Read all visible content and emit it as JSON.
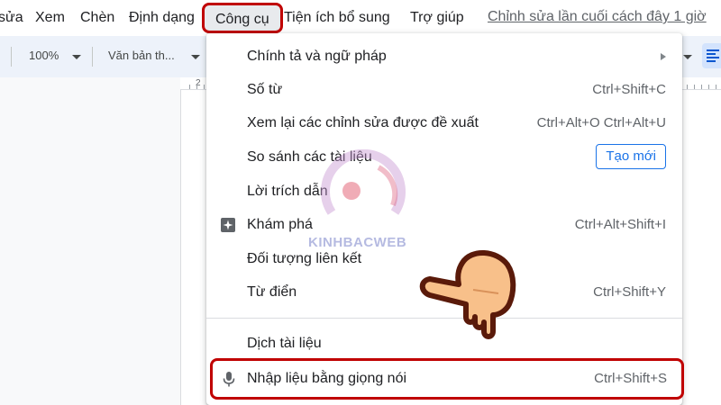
{
  "menubar": {
    "items": [
      "sửa",
      "Xem",
      "Chèn",
      "Định dạng",
      "Công cụ",
      "Tiện ích bổ sung",
      "Trợ giúp"
    ],
    "last_edit": "Chỉnh sửa lần cuối cách đây 1 giờ"
  },
  "toolbar": {
    "zoom": "100%",
    "style": "Văn bản th..."
  },
  "ruler": {
    "number": "2"
  },
  "tools_menu": {
    "items": [
      {
        "label": "Chính tả và ngữ pháp",
        "shortcut": ""
      },
      {
        "label": "Số từ",
        "shortcut": "Ctrl+Shift+C"
      },
      {
        "label": "Xem lại các chỉnh sửa được đề xuất",
        "shortcut": "Ctrl+Alt+O Ctrl+Alt+U"
      },
      {
        "label": "So sánh các tài liệu",
        "badge": "Tạo mới"
      },
      {
        "label": "Lời trích dẫn",
        "shortcut": ""
      },
      {
        "label": "Khám phá",
        "shortcut": "Ctrl+Alt+Shift+I",
        "icon": "explore-icon"
      },
      {
        "label": "Đối tượng liên kết",
        "shortcut": ""
      },
      {
        "label": "Từ điển",
        "shortcut": "Ctrl+Shift+Y"
      },
      {
        "label": "Dịch tài liệu",
        "shortcut": ""
      },
      {
        "label": "Nhập liệu bằng giọng nói",
        "shortcut": "Ctrl+Shift+S",
        "icon": "microphone-icon"
      }
    ]
  },
  "watermark": {
    "text": "KINHBACWEB"
  },
  "colors": {
    "highlight": "#c00000",
    "accent": "#1a73e8",
    "hand_fill": "#f8c08a",
    "hand_outline": "#5a1a0a"
  }
}
